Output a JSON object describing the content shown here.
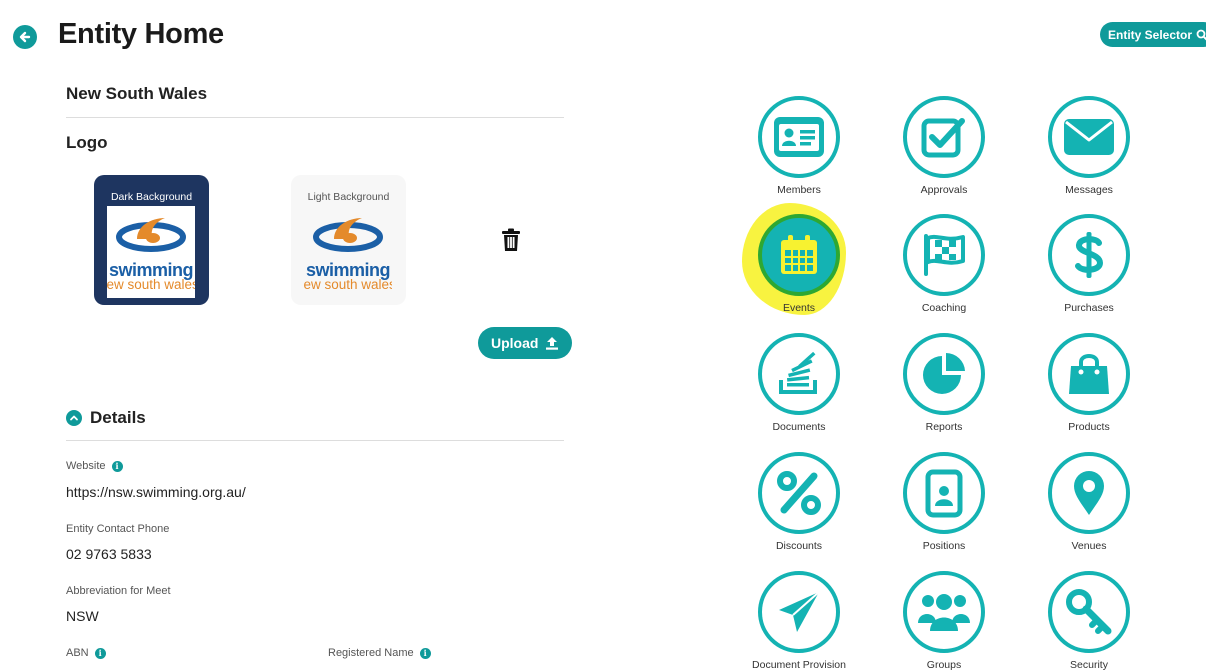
{
  "header": {
    "title": "Entity Home",
    "entity_selector_label": "Entity Selector"
  },
  "entity": {
    "name": "New South Wales"
  },
  "logo": {
    "heading": "Logo",
    "dark_caption": "Dark Background",
    "light_caption": "Light Background",
    "wordmark_line1": "swimming",
    "wordmark_line2": "new south wales",
    "upload_label": "Upload"
  },
  "details": {
    "heading": "Details",
    "fields": [
      {
        "label": "Website",
        "value": "https://nsw.swimming.org.au/"
      },
      {
        "label": "Entity Contact Phone",
        "value": "02 9763 5833"
      },
      {
        "label": "Abbreviation for Meet",
        "value": "NSW"
      },
      {
        "label": "ABN",
        "value": ""
      },
      {
        "label": "Registered Name",
        "value": ""
      }
    ]
  },
  "tiles": [
    {
      "label": "Members",
      "icon": "id-card-icon"
    },
    {
      "label": "Approvals",
      "icon": "checkbox-icon"
    },
    {
      "label": "Messages",
      "icon": "envelope-icon"
    },
    {
      "label": "Events",
      "icon": "calendar-icon"
    },
    {
      "label": "Coaching",
      "icon": "checkered-flag-icon"
    },
    {
      "label": "Purchases",
      "icon": "dollar-icon"
    },
    {
      "label": "Documents",
      "icon": "document-stack-icon"
    },
    {
      "label": "Reports",
      "icon": "pie-chart-icon"
    },
    {
      "label": "Products",
      "icon": "shopping-bag-icon"
    },
    {
      "label": "Discounts",
      "icon": "percent-icon"
    },
    {
      "label": "Positions",
      "icon": "id-badge-icon"
    },
    {
      "label": "Venues",
      "icon": "map-marker-icon"
    },
    {
      "label": "Document Provision",
      "icon": "paper-plane-icon"
    },
    {
      "label": "Groups",
      "icon": "users-icon"
    },
    {
      "label": "Security",
      "icon": "key-icon"
    }
  ],
  "colors": {
    "accent": "#0f9a9a",
    "tile_ring": "#14b3b3",
    "highlight": "#f7f230",
    "dark_logo_bg": "#1e3560"
  }
}
